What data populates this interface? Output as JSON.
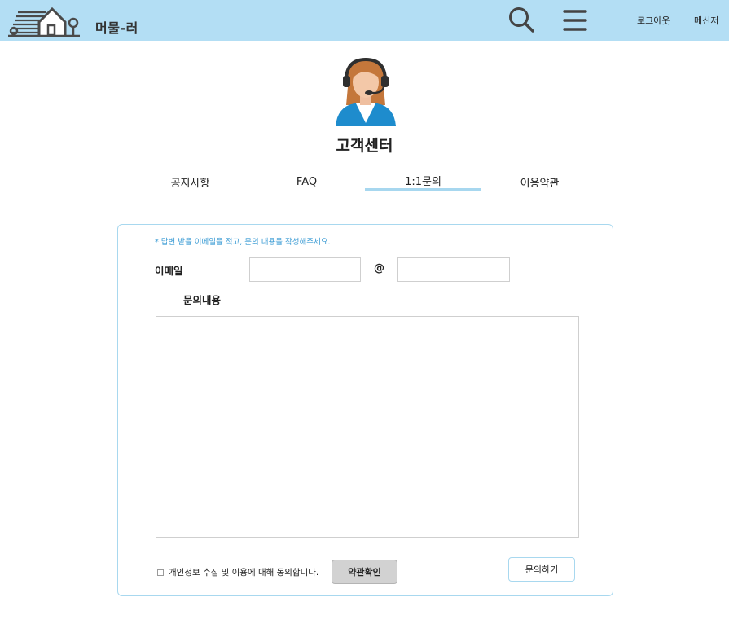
{
  "header": {
    "brand": "머물-러",
    "logout_label": "로그아웃",
    "messenger_label": "메신저",
    "icons": [
      "house-logo-icon",
      "search-icon",
      "hamburger-menu-icon"
    ]
  },
  "page": {
    "title": "고객센터",
    "agent_icon": "customer-service-agent-icon"
  },
  "tabs": [
    {
      "label": "공지사항",
      "active": false
    },
    {
      "label": "FAQ",
      "active": false
    },
    {
      "label": "1:1문의",
      "active": true
    },
    {
      "label": "이용약관",
      "active": false
    }
  ],
  "form": {
    "notice": "* 답변 받을 이메일을 적고, 문의 내용을 작성해주세요.",
    "email_label": "이메일",
    "email_id_value": "",
    "at_sign": "@",
    "email_domain_value": "",
    "content_label": "문의내용",
    "content_value": "",
    "agree_text": "개인정보 수집 및 이용에 대해 동의합니다.",
    "agree_checked": false,
    "terms_button": "약관확인",
    "submit_button": "문의하기"
  },
  "colors": {
    "header_bg": "#b3def4",
    "accent": "#a8d8ef",
    "notice_text": "#3a9bd4"
  }
}
